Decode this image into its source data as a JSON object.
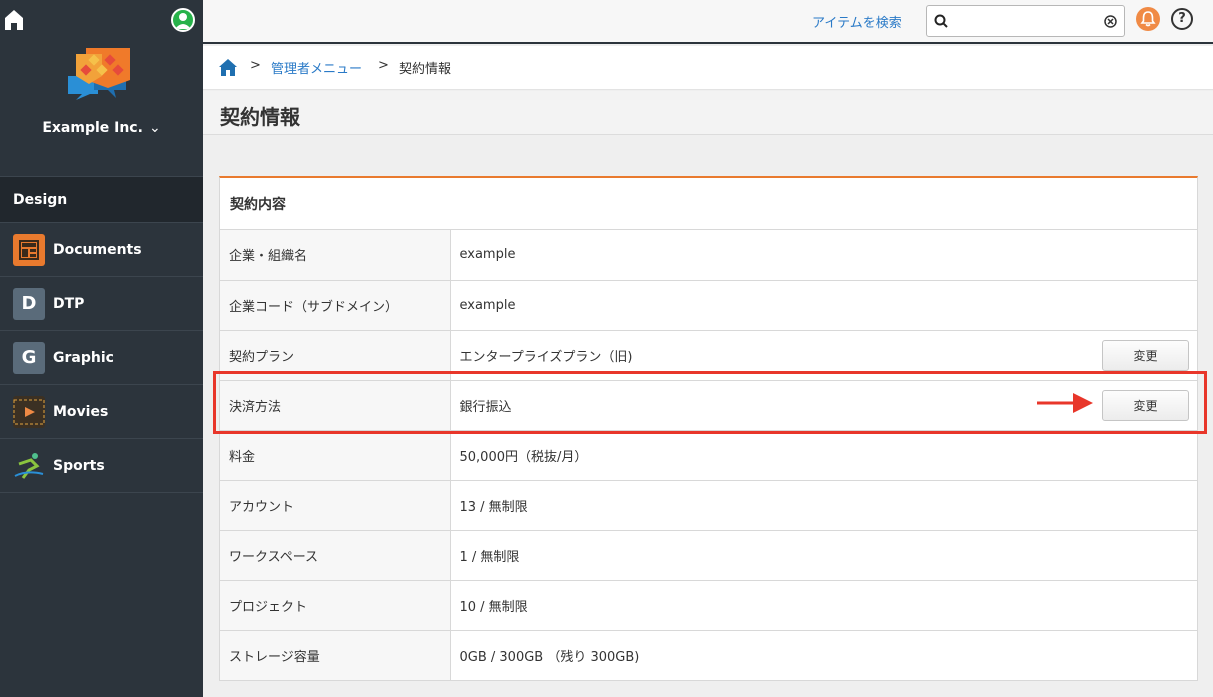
{
  "sidebar": {
    "company": "Example Inc.",
    "section": "Design",
    "items": [
      {
        "label": "Documents",
        "icon": "documents-icon"
      },
      {
        "label": "DTP",
        "letter": "D"
      },
      {
        "label": "Graphic",
        "letter": "G"
      },
      {
        "label": "Movies",
        "icon": "movies-icon"
      },
      {
        "label": "Sports",
        "icon": "sports-icon"
      }
    ]
  },
  "header": {
    "search_link": "アイテムを検索",
    "search_value": "",
    "help_glyph": "?"
  },
  "breadcrumb": {
    "separator": ">",
    "admin_menu": "管理者メニュー",
    "current": "契約情報"
  },
  "page_title": "契約情報",
  "panel": {
    "title": "契約内容",
    "change_label": "変更",
    "rows": [
      {
        "key": "企業・組織名",
        "value": "example"
      },
      {
        "key": "企業コード（サブドメイン）",
        "value": "example"
      },
      {
        "key": "契約プラン",
        "value": "エンタープライズプラン（旧)"
      },
      {
        "key": "決済方法",
        "value": "銀行振込"
      },
      {
        "key": "料金",
        "value": "50,000円（税抜/月）"
      },
      {
        "key": "アカウント",
        "value": "13 / 無制限"
      },
      {
        "key": "ワークスペース",
        "value": "1 / 無制限"
      },
      {
        "key": "プロジェクト",
        "value": "10 / 無制限"
      },
      {
        "key": "ストレージ容量",
        "value": "0GB / 300GB （残り 300GB)"
      }
    ]
  },
  "colors": {
    "sidebar_bg": "#2c343c",
    "accent_orange": "#e97a2e",
    "link_blue": "#2a7ac7",
    "highlight_red": "#e8362a",
    "user_green": "#27b24a"
  }
}
